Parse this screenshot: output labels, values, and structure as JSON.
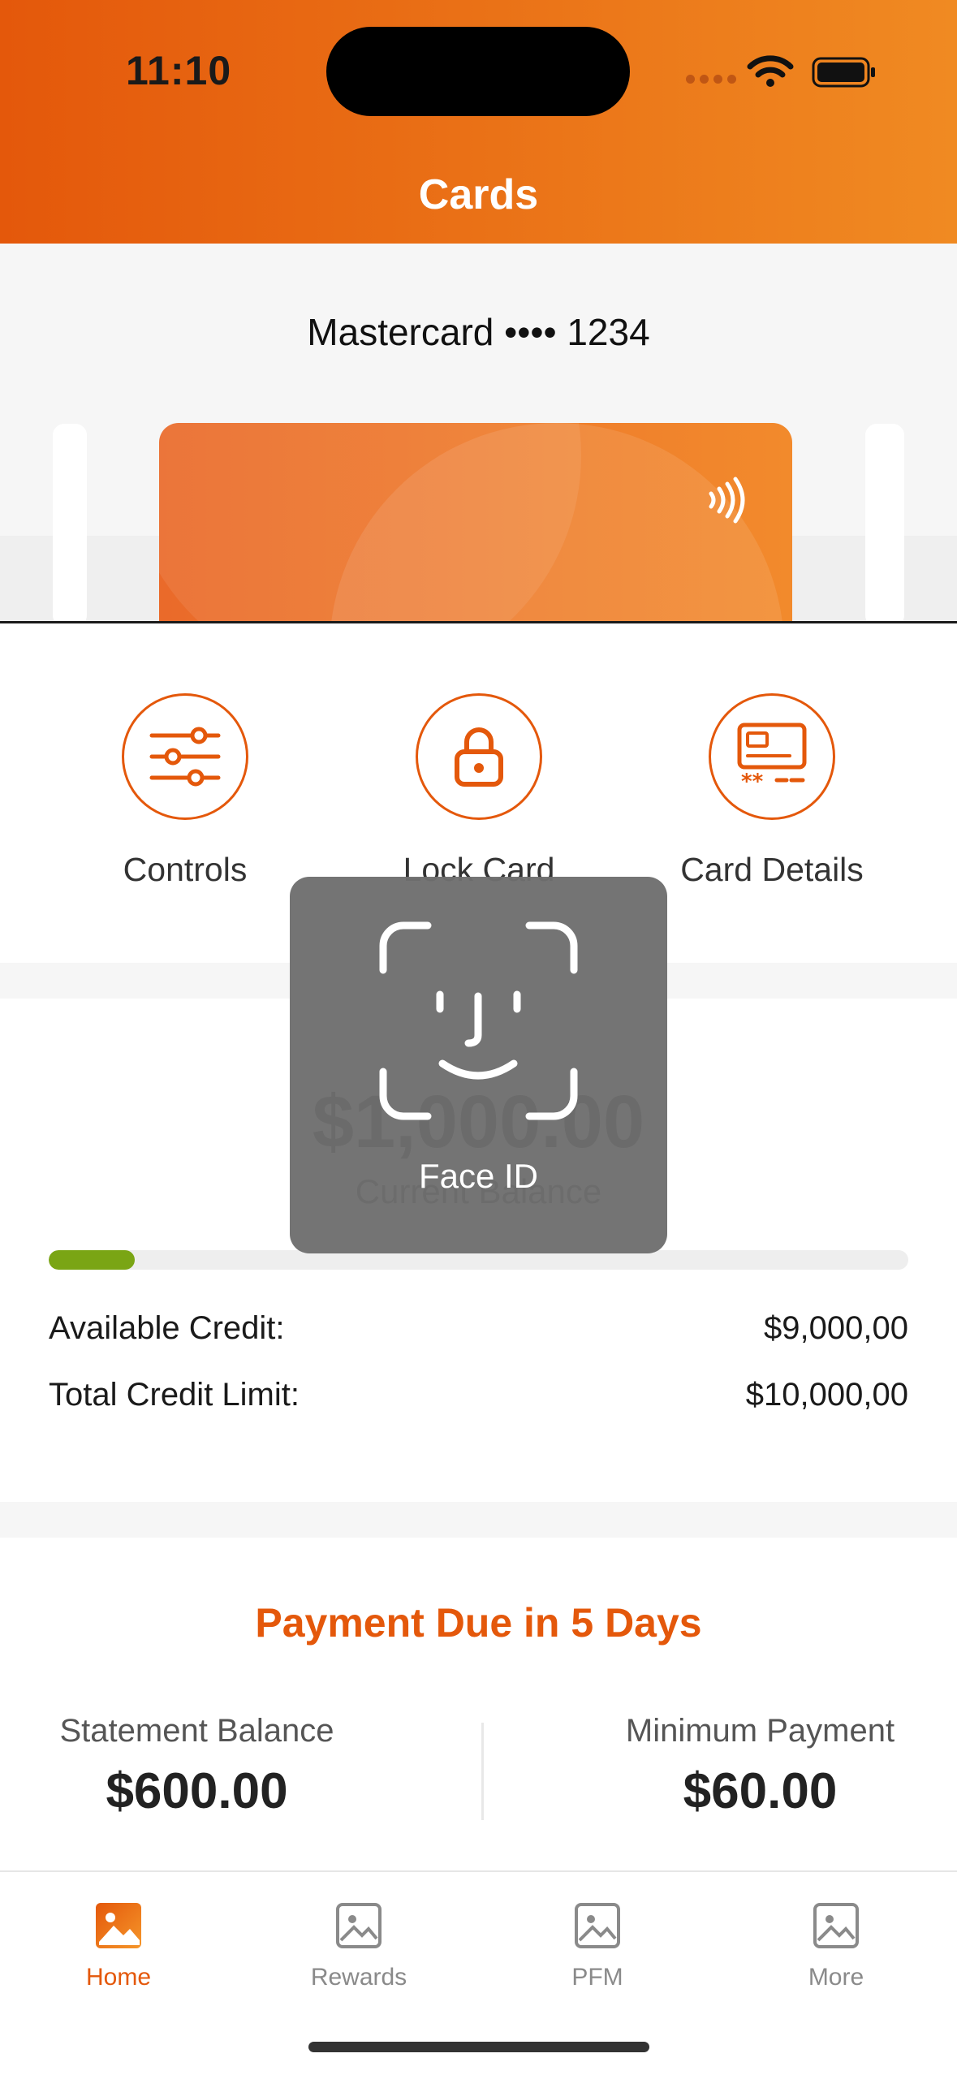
{
  "status_bar": {
    "time": "11:10"
  },
  "header": {
    "title": "Cards"
  },
  "card": {
    "name": "Mastercard •••• 1234"
  },
  "actions": [
    {
      "label": "Controls",
      "icon": "sliders-icon"
    },
    {
      "label": "Lock Card",
      "icon": "lock-icon"
    },
    {
      "label": "Card Details",
      "icon": "card-details-icon"
    }
  ],
  "balance": {
    "amount": "$1,000.00",
    "label": "Current Balance",
    "utilization_percent": 10,
    "available_label": "Available Credit:",
    "available_value": "$9,000,00",
    "limit_label": "Total Credit Limit:",
    "limit_value": "$10,000,00"
  },
  "payment": {
    "title": "Payment Due in 5 Days",
    "statement_label": "Statement Balance",
    "statement_value": "$600.00",
    "minimum_label": "Minimum Payment",
    "minimum_value": "$60.00"
  },
  "tabs": [
    {
      "label": "Home",
      "active": true
    },
    {
      "label": "Rewards",
      "active": false
    },
    {
      "label": "PFM",
      "active": false
    },
    {
      "label": "More",
      "active": false
    }
  ],
  "faceid": {
    "label": "Face ID"
  },
  "colors": {
    "accent": "#e4580b",
    "progress": "#7aa514"
  }
}
